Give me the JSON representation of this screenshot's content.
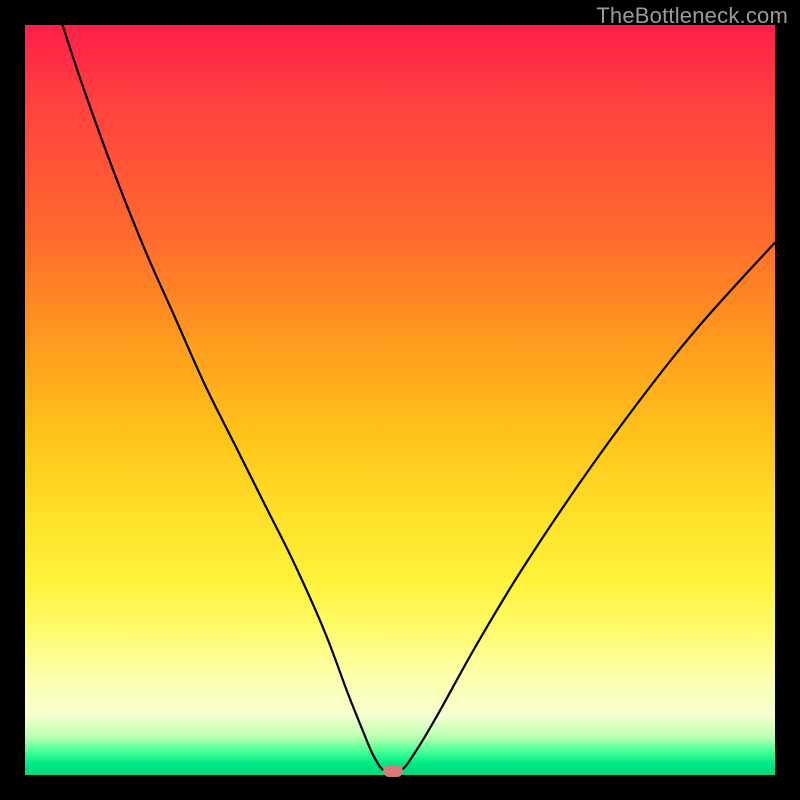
{
  "watermark": {
    "text": "TheBottleneck.com"
  },
  "chart_data": {
    "type": "line",
    "title": "",
    "xlabel": "",
    "ylabel": "",
    "xlim": [
      0,
      100
    ],
    "ylim": [
      0,
      100
    ],
    "grid": false,
    "legend": false,
    "background_gradient": {
      "direction": "vertical",
      "stops": [
        {
          "pos": 0.0,
          "color": "#ff1f4a"
        },
        {
          "pos": 0.28,
          "color": "#ff6a2e"
        },
        {
          "pos": 0.55,
          "color": "#ffc41a"
        },
        {
          "pos": 0.8,
          "color": "#fffb66"
        },
        {
          "pos": 0.95,
          "color": "#b8ffb0"
        },
        {
          "pos": 1.0,
          "color": "#00d979"
        }
      ]
    },
    "series": [
      {
        "name": "bottleneck-curve",
        "color": "#000000",
        "x": [
          5,
          8,
          12,
          16,
          20,
          24,
          28,
          32,
          36,
          40,
          43,
          45,
          46.5,
          48,
          50,
          52,
          55,
          60,
          66,
          74,
          82,
          90,
          100
        ],
        "y": [
          100,
          91,
          80,
          70,
          61,
          52,
          44,
          36,
          28,
          19,
          11,
          6,
          2.5,
          0.5,
          0.5,
          3,
          8,
          17,
          27,
          39,
          50,
          60,
          71
        ]
      }
    ],
    "marker": {
      "name": "optimal-point",
      "x": 49,
      "y": 0.5,
      "color": "#d77a7a",
      "shape": "pill"
    }
  }
}
